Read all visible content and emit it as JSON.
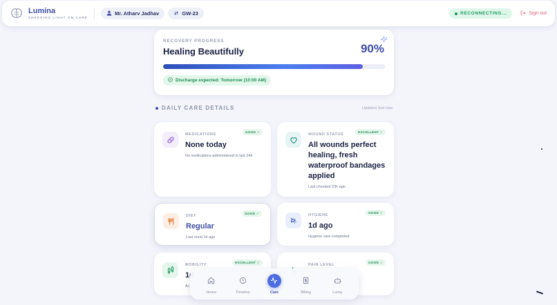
{
  "header": {
    "brand_name": "Lumina",
    "brand_tagline": "SHEDDING LIGHT ON CARE",
    "patient_name": "Mr. Atharv Jadhav",
    "ward": "GW-23",
    "status": "RECONNECTING...",
    "signout": "Sign out"
  },
  "recovery": {
    "label": "RECOVERY PROGRESS",
    "title": "Healing Beautifully",
    "percent_text": "90%",
    "progress_fraction": 0.9,
    "discharge": "Discharge expected: Tomorrow (10:00 AM)"
  },
  "section": {
    "title": "DAILY CARE DETAILS",
    "updated": "Updated Just now"
  },
  "cards": {
    "medications": {
      "label": "MEDICATIONS",
      "badge": "GOOD ✓",
      "value": "None today",
      "sub": "No medications administered in last 24h",
      "icon": "pill-icon"
    },
    "wound": {
      "label": "WOUND STATUS",
      "badge": "EXCELLENT ✓",
      "value": "All wounds perfect healing, fresh waterproof bandages applied",
      "sub": "Last checked 23h ago",
      "icon": "heart-icon"
    },
    "diet": {
      "label": "DIET",
      "badge": "GOOD ✓",
      "value": "Regular",
      "sub": "Last meal 1d ago",
      "icon": "utensils-icon"
    },
    "hygiene": {
      "label": "HYGIENE",
      "badge": "GOOD ✓",
      "value": "1d ago",
      "sub": "Hygiene care completed",
      "icon": "shower-icon"
    },
    "mobility": {
      "label": "MOBILITY",
      "badge": "EXCELLENT ✓",
      "value": "1d",
      "sub": "Ac",
      "icon": "footprints-icon"
    },
    "pain": {
      "label": "PAIN LEVEL",
      "badge": "GOOD ✓",
      "value": "",
      "sub": "",
      "icon": "activity-icon"
    }
  },
  "nav": {
    "items": [
      {
        "label": "Home",
        "icon": "home-icon"
      },
      {
        "label": "Timeline",
        "icon": "clock-icon"
      },
      {
        "label": "Care",
        "icon": "activity-icon"
      },
      {
        "label": "Billing",
        "icon": "receipt-icon"
      },
      {
        "label": "Luma",
        "icon": "bot-icon"
      }
    ],
    "active": "Care"
  },
  "colors": {
    "accent": "#3d4ea6",
    "active_nav": "#4d6de3",
    "success": "#1c8a51",
    "danger": "#e0607a"
  }
}
